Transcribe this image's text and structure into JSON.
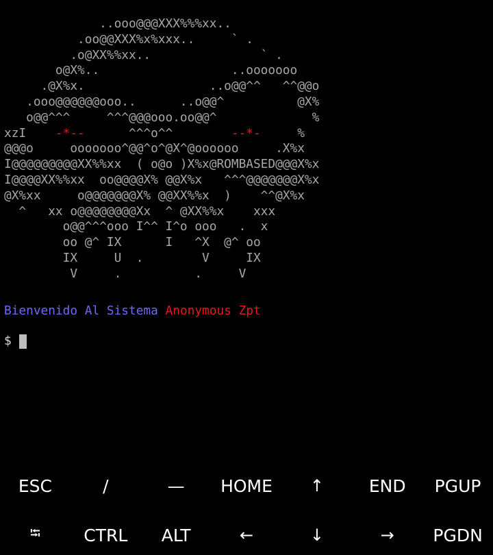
{
  "terminal": {
    "ascii_art": [
      [
        {
          "t": "             ..ooo@@@XXX%%%xx.."
        }
      ],
      [
        {
          "t": "          .oo@@XXX%x%xxx..     ` ."
        }
      ],
      [
        {
          "t": "         .o@XX%%xx..               ` ."
        }
      ],
      [
        {
          "t": "       o@X%..                  ..ooooooo"
        }
      ],
      [
        {
          "t": "     .@X%x.                 ..o@@^^   ^^@@o"
        }
      ],
      [
        {
          "t": "   .ooo@@@@@@ooo..      ..o@@^          @X%"
        }
      ],
      [
        {
          "t": "   o@@^^^     ^^^@@@ooo.oo@@^             %"
        }
      ],
      [
        {
          "t": "xzI    "
        },
        {
          "t": "-*--",
          "c": "red"
        },
        {
          "t": "      ^^^o^^        "
        },
        {
          "t": "--*-",
          "c": "red"
        },
        {
          "t": "     %"
        }
      ],
      [
        {
          "t": "@@@o     ooooooo^@@^o^@X^@oooooo     .X%x"
        }
      ],
      [
        {
          "t": "I@@@@@@@@@XX%%xx  ( o@o )X%x@ROMBASED@@@X%x"
        }
      ],
      [
        {
          "t": "I@@@@XX%%xx  oo@@@@X% @@X%x   ^^^@@@@@@@X%x"
        }
      ],
      [
        {
          "t": "@X%xx     o@@@@@@@X% @@XX%%x  )    ^^@X%x"
        }
      ],
      [
        {
          "t": "  ^   xx o@@@@@@@@Xx  ^ @XX%%x    xxx"
        }
      ],
      [
        {
          "t": "        o@@^^^ooo I^^ I^o ooo   .  x"
        }
      ],
      [
        {
          "t": "        oo @^ IX      I   ^X  @^ oo"
        }
      ],
      [
        {
          "t": "        IX     U  .        V     IX"
        }
      ],
      [
        {
          "t": "         V     .          .     V"
        }
      ]
    ],
    "welcome_part1": "Bienvenido Al Sistema",
    "welcome_part2": "Anonymous Zpt",
    "prompt": "$"
  },
  "extra_keys": {
    "row1": [
      "ESC",
      "/",
      "—",
      "HOME",
      "↑",
      "END",
      "PGUP"
    ],
    "row2": [
      "⭾",
      "CTRL",
      "ALT",
      "←",
      "↓",
      "→",
      "PGDN"
    ]
  },
  "colors": {
    "background": "#000000",
    "ascii_gray": "#a8a8a8",
    "ascii_red": "#e01b1b",
    "welcome_blue": "#6b6bf2",
    "welcome_red": "#e01b1b",
    "key_text": "#ffffff",
    "cursor": "#bdbdbd"
  }
}
